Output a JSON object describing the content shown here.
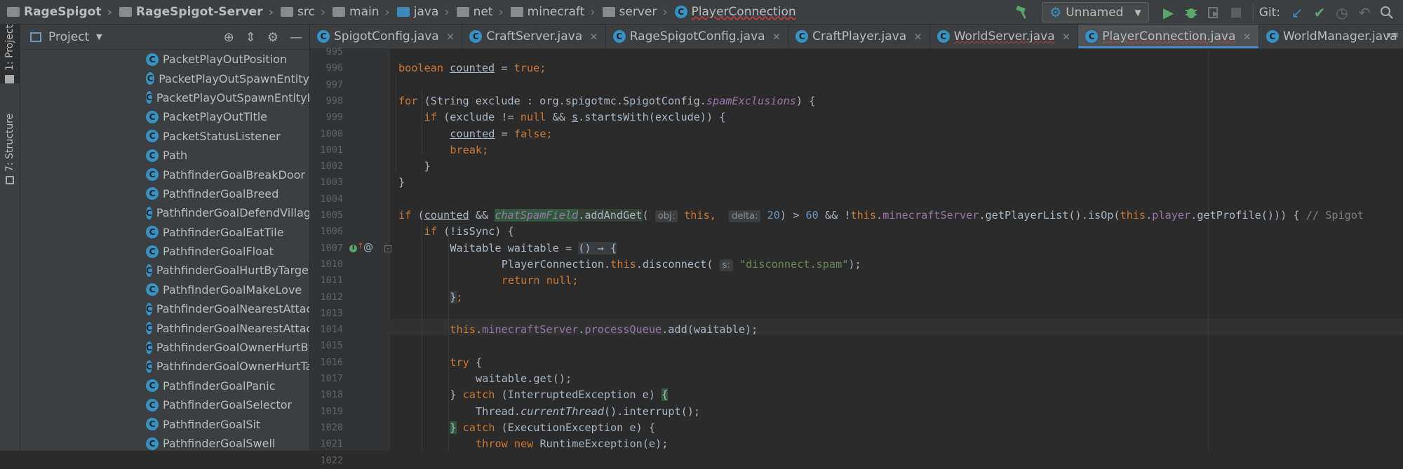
{
  "breadcrumb": [
    {
      "label": "RageSpigot",
      "icon": "project-folder-icon",
      "bold": true
    },
    {
      "label": "RageSpigot-Server",
      "icon": "module-folder-icon",
      "bold": true
    },
    {
      "label": "src",
      "icon": "folder-icon"
    },
    {
      "label": "main",
      "icon": "folder-icon"
    },
    {
      "label": "java",
      "icon": "source-folder-icon"
    },
    {
      "label": "net",
      "icon": "package-icon"
    },
    {
      "label": "minecraft",
      "icon": "package-icon"
    },
    {
      "label": "server",
      "icon": "package-icon"
    },
    {
      "label": "PlayerConnection",
      "icon": "class-icon"
    }
  ],
  "toolbar": {
    "run_config": "Unnamed",
    "git_label": "Git:"
  },
  "left_strip": {
    "project_tab": "1: Project",
    "structure_tab": "7: Structure"
  },
  "project_panel": {
    "title": "Project",
    "items": [
      "PacketPlayOutPosition",
      "PacketPlayOutSpawnEntity",
      "PacketPlayOutSpawnEntityLiv",
      "PacketPlayOutTitle",
      "PacketStatusListener",
      "Path",
      "PathfinderGoalBreakDoor",
      "PathfinderGoalBreed",
      "PathfinderGoalDefendVillage",
      "PathfinderGoalEatTile",
      "PathfinderGoalFloat",
      "PathfinderGoalHurtByTarget",
      "PathfinderGoalMakeLove",
      "PathfinderGoalNearestAttack",
      "PathfinderGoalNearestAttack",
      "PathfinderGoalOwnerHurtBy",
      "PathfinderGoalOwnerHurtTar",
      "PathfinderGoalPanic",
      "PathfinderGoalSelector",
      "PathfinderGoalSit",
      "PathfinderGoalSwell"
    ]
  },
  "tabs": [
    {
      "label": "SpigotConfig.java",
      "active": false,
      "error": false
    },
    {
      "label": "CraftServer.java",
      "active": false,
      "error": false
    },
    {
      "label": "RageSpigotConfig.java",
      "active": false,
      "error": false
    },
    {
      "label": "CraftPlayer.java",
      "active": false,
      "error": false
    },
    {
      "label": "WorldServer.java",
      "active": false,
      "error": true
    },
    {
      "label": "PlayerConnection.java",
      "active": true,
      "error": true
    },
    {
      "label": "WorldManager.java",
      "active": false,
      "error": false
    }
  ],
  "line_numbers": [
    "995",
    "996",
    "997",
    "998",
    "999",
    "1000",
    "1001",
    "1002",
    "1003",
    "1004",
    "1005",
    "1006",
    "1007",
    "1010",
    "1011",
    "1012",
    "1013",
    "1014",
    "1015",
    "1016",
    "1017",
    "1018",
    "1019",
    "1020",
    "1021",
    "1022"
  ],
  "code": {
    "l996_a": "boolean ",
    "l996_b": "counted",
    "l996_c": " = ",
    "l996_d": "true",
    "l996_e": ";",
    "l998_a": "for",
    "l998_b": " (String exclude : org.spigotmc.SpigotConfig.",
    "l998_c": "spamExclusions",
    "l998_d": ") {",
    "l999_a": "if",
    "l999_b": " (exclude != ",
    "l999_c": "null",
    "l999_d": " && ",
    "l999_e": "s",
    "l999_f": ".startsWith(exclude)) {",
    "l1000_a": "counted",
    "l1000_b": " = ",
    "l1000_c": "false",
    "l1000_d": ";",
    "l1001_a": "break",
    "l1001_b": ";",
    "l1002": "}",
    "l1003": "}",
    "l1005_a": "if",
    "l1005_b": " (",
    "l1005_c": "counted",
    "l1005_d": " && ",
    "l1005_e": "chatSpamField",
    "l1005_f": ".addAndGet",
    "l1005_g": "( ",
    "l1005_h": "obj:",
    "l1005_i": " this",
    "l1005_j": ",  ",
    "l1005_k": "delta:",
    "l1005_l": " 20",
    "l1005_m": ") > ",
    "l1005_n": "60",
    "l1005_o": " && !",
    "l1005_p": "this",
    "l1005_q": ".",
    "l1005_r": "minecraftServer",
    "l1005_s": ".getPlayerList().isOp(",
    "l1005_t": "this",
    "l1005_u": ".",
    "l1005_v": "player",
    "l1005_w": ".getProfile())) { ",
    "l1005_x": "// Spigot",
    "l1006_a": "if",
    "l1006_b": " (!isSync) {",
    "l1007_a": "Waitable waitable = ",
    "l1007_b": "() → {",
    "l1010_a": "PlayerConnection.",
    "l1010_b": "this",
    "l1010_c": ".disconnect( ",
    "l1010_d": "s:",
    "l1010_e": " \"disconnect.spam\"",
    "l1010_f": ");",
    "l1011_a": "return null",
    "l1011_b": ";",
    "l1012_a": "}",
    "l1012_b": ";",
    "l1015_a": "this",
    "l1015_b": ".",
    "l1015_c": "minecraftServer",
    "l1015_d": ".",
    "l1015_e": "processQueue",
    "l1015_f": ".add(waitable);",
    "l1017_a": "try",
    "l1017_b": " {",
    "l1018": "waitable.get();",
    "l1019_a": "} ",
    "l1019_b": "catch",
    "l1019_c": " (InterruptedException e) ",
    "l1019_d": "{",
    "l1020_a": "Thread.",
    "l1020_b": "currentThread",
    "l1020_c": "().interrupt();",
    "l1021_a": "}",
    "l1021_b": " catch",
    "l1021_c": " (ExecutionException e) {",
    "l1022_a": "throw new",
    "l1022_b": " RuntimeException(e);"
  }
}
